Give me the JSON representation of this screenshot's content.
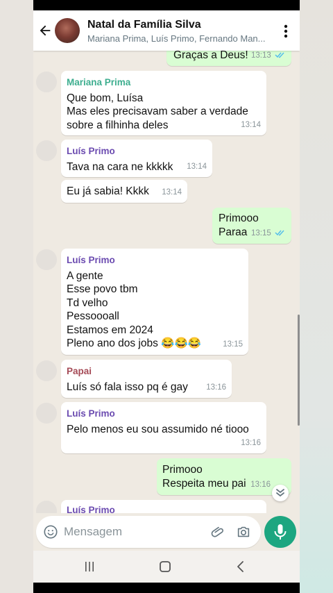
{
  "header": {
    "title": "Natal da Família Silva",
    "subtitle": "Mariana Prima, Luís Primo, Fernando Man..."
  },
  "messages": [
    {
      "dir": "out",
      "text": "Graças a Deus!",
      "time": "13:13",
      "read": true
    },
    {
      "dir": "in",
      "sender": "Mariana Prima",
      "text": "Que bom, Luísa\nMas eles precisavam saber a verdade\nsobre a filhinha deles",
      "time": "13:14"
    },
    {
      "dir": "in",
      "sender": "Luís Primo",
      "text": "Tava na cara ne kkkkk",
      "time": "13:14"
    },
    {
      "dir": "in",
      "text": "Eu já sabia! Kkkk",
      "time": "13:14"
    },
    {
      "dir": "out",
      "text": "Primooo\nParaa",
      "time": "13:15",
      "read": true
    },
    {
      "dir": "in",
      "sender": "Luís Primo",
      "text": "A gente\nEsse povo tbm\nTd velho\nPessoooall\nEstamos em 2024\nPleno ano dos jobs 😂😂😂",
      "time": "13:15"
    },
    {
      "dir": "in",
      "sender": "Papai",
      "text": "Luís só fala isso pq é gay",
      "time": "13:16"
    },
    {
      "dir": "in",
      "sender": "Luís Primo",
      "text": "Pelo menos eu sou assumido né tiooo",
      "time": "13:16"
    },
    {
      "dir": "out",
      "text": "Primooo\nRespeita meu pai",
      "time": "13:16",
      "read": false
    },
    {
      "dir": "in",
      "sender": "Luís Primo",
      "text": "",
      "time": ""
    }
  ],
  "input": {
    "placeholder": "Mensagem"
  },
  "icons": {
    "back": "arrow-left-icon",
    "menu": "more-vertical-icon",
    "emoji": "emoji-icon",
    "attach": "paperclip-icon",
    "camera": "camera-icon",
    "mic": "microphone-icon",
    "scroll_down": "chevron-double-down-icon"
  },
  "colors": {
    "accent": "#1da680",
    "outgoing_bubble": "#d9fdd3",
    "incoming_bubble": "#ffffff",
    "chat_background": "#efeae2",
    "read_ticks": "#53bdeb"
  }
}
